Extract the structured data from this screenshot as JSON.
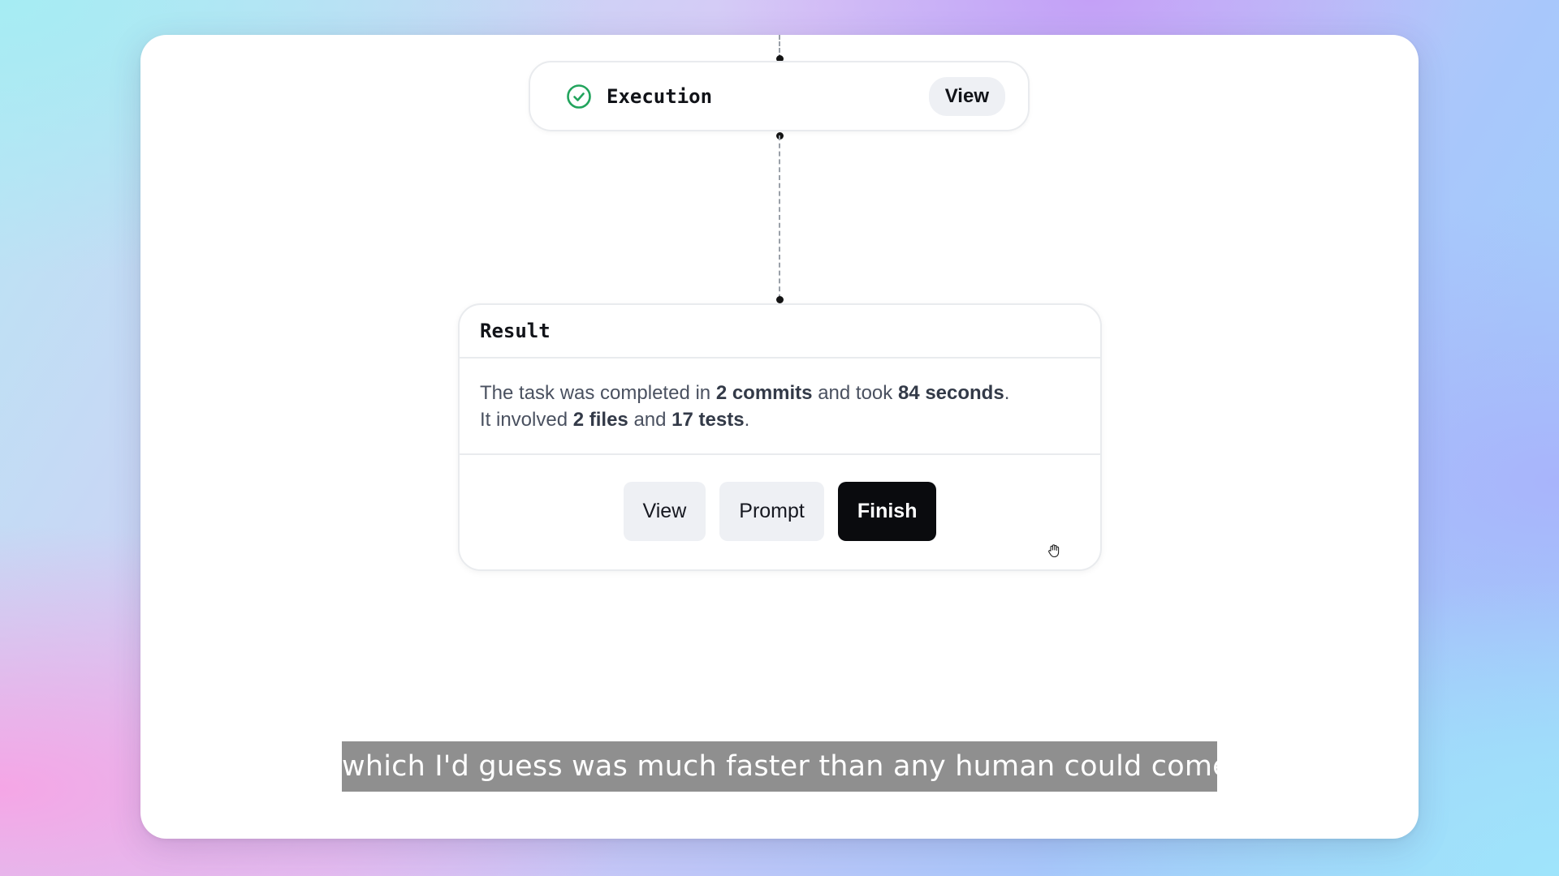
{
  "execution_node": {
    "title": "Execution",
    "status_icon": "check-circle-icon",
    "view_label": "View",
    "status_color": "#22a45d"
  },
  "result_card": {
    "title": "Result",
    "summary": {
      "line1_prefix": "The task was completed in ",
      "commits": "2 commits",
      "line1_mid": " and took ",
      "duration": "84 seconds",
      "line1_suffix": ".",
      "line2_prefix": "It involved ",
      "files": "2 files",
      "line2_mid": " and ",
      "tests": "17 tests",
      "line2_suffix": "."
    },
    "actions": {
      "view_label": "View",
      "prompt_label": "Prompt",
      "finish_label": "Finish"
    }
  },
  "cursor_icon": "grab-hand-icon",
  "caption": {
    "text": "which I'd guess was much faster than any human could come"
  }
}
